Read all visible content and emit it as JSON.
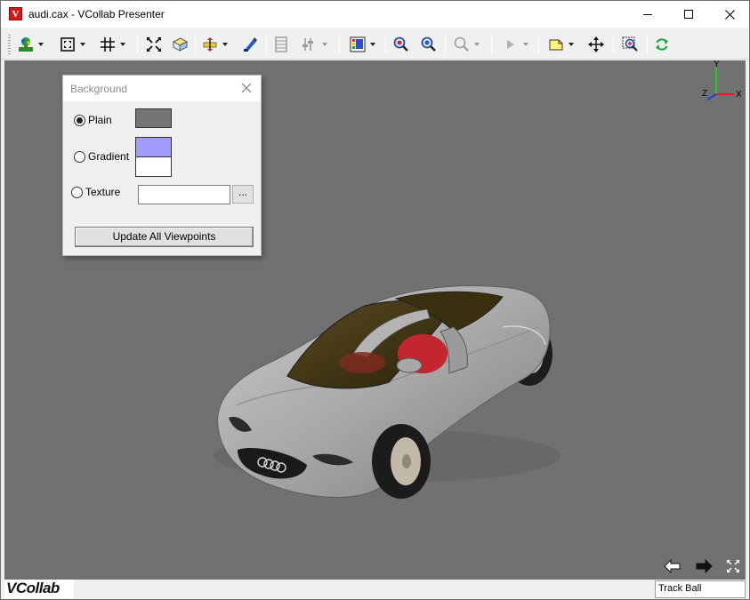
{
  "window": {
    "title": "audi.cax - VCollab Presenter",
    "app_icon_glyph": "V"
  },
  "toolbar": {
    "tools": [
      {
        "icon": "scene-tree-icon",
        "dropdown": true,
        "enabled": true
      },
      {
        "icon": "fit-view-icon",
        "dropdown": true,
        "enabled": true
      },
      {
        "icon": "grid-icon",
        "dropdown": true,
        "enabled": true
      },
      {
        "icon": "explode-icon",
        "dropdown": false,
        "enabled": true
      },
      {
        "icon": "box-select-icon",
        "dropdown": false,
        "enabled": true
      },
      {
        "icon": "section-plane-icon",
        "dropdown": true,
        "enabled": true
      },
      {
        "icon": "paint-icon",
        "dropdown": false,
        "enabled": true
      },
      {
        "icon": "film-icon",
        "dropdown": false,
        "enabled": false
      },
      {
        "icon": "slider-icon",
        "dropdown": true,
        "enabled": false
      },
      {
        "icon": "color-legend-icon",
        "dropdown": true,
        "enabled": true
      },
      {
        "icon": "zoom-in-icon",
        "dropdown": false,
        "enabled": true
      },
      {
        "icon": "zoom-out-icon",
        "dropdown": false,
        "enabled": true
      },
      {
        "icon": "zoom-box-icon",
        "dropdown": true,
        "enabled": false
      },
      {
        "icon": "play-icon",
        "dropdown": true,
        "enabled": false
      },
      {
        "icon": "note-icon",
        "dropdown": true,
        "enabled": true
      },
      {
        "icon": "pan-icon",
        "dropdown": false,
        "enabled": true
      },
      {
        "icon": "zoom-window-icon",
        "dropdown": false,
        "enabled": true
      },
      {
        "icon": "refresh-icon",
        "dropdown": false,
        "enabled": true
      }
    ]
  },
  "triad": {
    "x": "X",
    "y": "Y",
    "z": "Z"
  },
  "background_dialog": {
    "title": "Background",
    "options": [
      {
        "label": "Plain",
        "selected": true
      },
      {
        "label": "Gradient",
        "selected": false
      },
      {
        "label": "Texture",
        "selected": false
      }
    ],
    "plain_color": "#757575",
    "gradient_top": "#a29cff",
    "gradient_bottom": "#ffffff",
    "texture_value": "",
    "browse_label": "...",
    "update_button": "Update All Viewpoints"
  },
  "viewport": {
    "background": "#717171"
  },
  "statusbar": {
    "logo": "VCollab",
    "mode": "Track Ball"
  }
}
